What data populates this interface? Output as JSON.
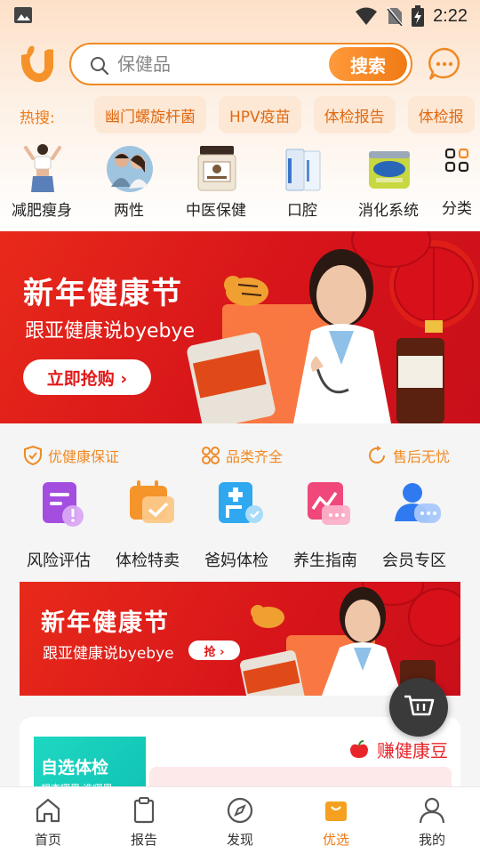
{
  "status_bar": {
    "time": "2:22"
  },
  "search": {
    "placeholder": "保健品",
    "button_label": "搜索"
  },
  "hot_search": {
    "label": "热搜:",
    "items": [
      "幽门螺旋杆菌",
      "HPV疫苗",
      "体检报告",
      "体检报"
    ]
  },
  "categories": [
    {
      "label": "减肥瘦身",
      "icon": "fitness-woman-image"
    },
    {
      "label": "两性",
      "icon": "couple-image"
    },
    {
      "label": "中医保健",
      "icon": "tcm-jar-image"
    },
    {
      "label": "口腔",
      "icon": "toothpaste-image"
    },
    {
      "label": "消化系统",
      "icon": "probiotic-can-image"
    },
    {
      "label": "分类",
      "icon": "grid-icon"
    }
  ],
  "banner": {
    "title": "新年健康节",
    "subtitle": "跟亚健康说byebye",
    "cta": "立即抢购 ›"
  },
  "guarantees": [
    "优健康保证",
    "品类齐全",
    "售后无忧"
  ],
  "services": [
    {
      "label": "风险评估",
      "icon": "risk-doc-icon",
      "color": "#a44ee0"
    },
    {
      "label": "体检特卖",
      "icon": "calendar-check-icon",
      "color": "#f5942a"
    },
    {
      "label": "爸妈体检",
      "icon": "medical-card-icon",
      "color": "#2fa8f0"
    },
    {
      "label": "养生指南",
      "icon": "health-guide-icon",
      "color": "#f0487a"
    },
    {
      "label": "会员专区",
      "icon": "member-icon",
      "color": "#2f7af0"
    }
  ],
  "banner2": {
    "title": "新年健康节",
    "subtitle": "跟亚健康说byebye",
    "cta": "抢 ›"
  },
  "promo_card": {
    "left_title": "自选体检",
    "left_sub": "想查哪里 选哪里",
    "earn_label": "赚健康豆"
  },
  "tabbar": [
    {
      "label": "首页",
      "icon": "home-icon"
    },
    {
      "label": "报告",
      "icon": "clipboard-icon"
    },
    {
      "label": "发现",
      "icon": "compass-icon"
    },
    {
      "label": "优选",
      "icon": "shopping-bag-icon",
      "active": true
    },
    {
      "label": "我的",
      "icon": "user-icon"
    }
  ],
  "colors": {
    "accent": "#f07a14",
    "banner_red": "#d6141a",
    "earn_red": "#e8262a"
  }
}
